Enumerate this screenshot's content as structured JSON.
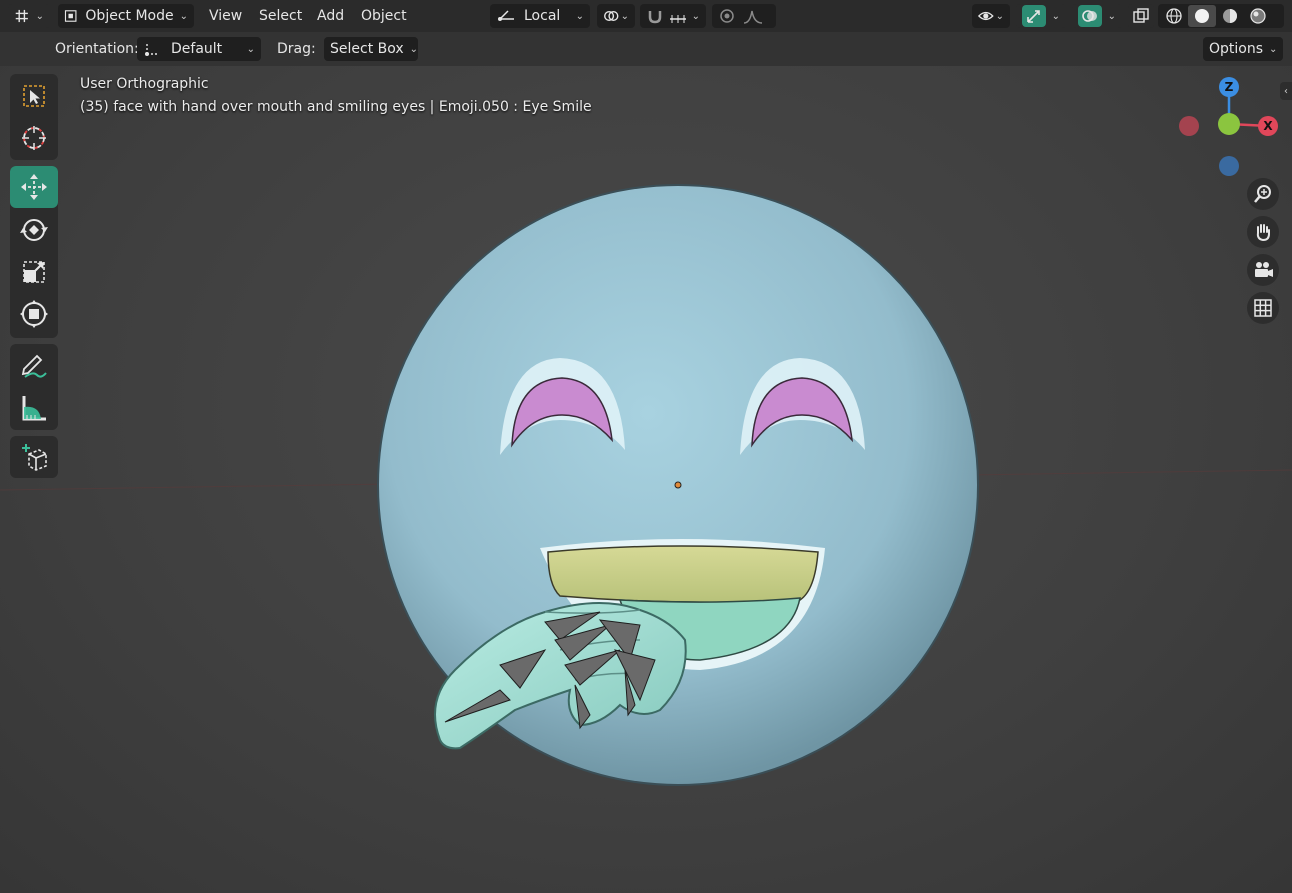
{
  "header": {
    "editor_type_icon": "axis-grid-icon",
    "mode": "Object Mode",
    "menus": [
      "View",
      "Select",
      "Add",
      "Object"
    ],
    "transform_orientation": "Local",
    "options_label": "Options"
  },
  "tool_settings": {
    "orientation_label": "Orientation:",
    "orientation_value": "Default",
    "drag_label": "Drag:",
    "drag_value": "Select Box"
  },
  "viewport": {
    "view_name": "User Orthographic",
    "object_info": "(35) face with hand over mouth and smiling eyes | Emoji.050 : Eye Smile"
  },
  "gizmo": {
    "z_label": "Z",
    "x_label": "X",
    "colors": {
      "x": "#e0475a",
      "y": "#8bc53f",
      "z": "#3b8ee3"
    }
  },
  "toolbar": {
    "tools": [
      "select-box-icon",
      "cursor-icon",
      "move-icon",
      "rotate-icon",
      "scale-icon",
      "transform-icon",
      "annotate-icon",
      "measure-icon",
      "add-cube-icon"
    ],
    "active": "move-icon"
  },
  "colors": {
    "accent": "#2c8c73",
    "face": "#9cc6d6",
    "eye_inner": "#c98bd0",
    "mouth_top": "#c9cf8a",
    "mouth_bottom": "#8fd6c0",
    "hand": "#a8e0d8"
  }
}
